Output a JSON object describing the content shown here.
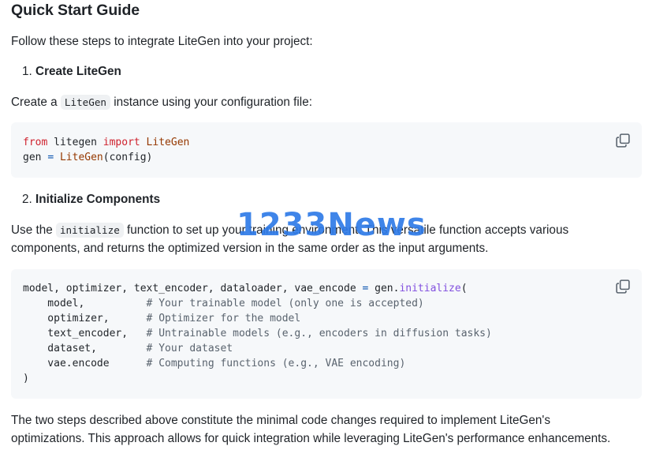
{
  "title": "Quick Start Guide",
  "intro": "Follow these steps to integrate LiteGen into your project:",
  "step1": {
    "number": "1.",
    "title": "Create LiteGen"
  },
  "step1_text": {
    "before": "Create a",
    "code": "LiteGen",
    "after": "instance using your configuration file:"
  },
  "code1": {
    "line1": {
      "from": "from",
      "module": " litegen ",
      "import": "import",
      "name": " LiteGen"
    },
    "line2": {
      "var": "gen ",
      "eq": "=",
      "call": " LiteGen",
      "args": "(config)"
    }
  },
  "step2": {
    "number": "2.",
    "title": "Initialize Components"
  },
  "step2_text": {
    "before": "Use the",
    "code": "initialize",
    "after_line1": "function to set up your training environment. This versatile function accepts various",
    "line2": "components, and returns the optimized version in the same order as the input arguments."
  },
  "code2": {
    "head": {
      "vars": "model, optimizer, text_encoder, dataloader, vae_encode ",
      "eq": "=",
      "obj": " gen.",
      "fn": "initialize",
      "paren": "("
    },
    "rows": [
      {
        "arg": "    model,          ",
        "comment": "# Your trainable model (only one is accepted)"
      },
      {
        "arg": "    optimizer,      ",
        "comment": "# Optimizer for the model"
      },
      {
        "arg": "    text_encoder,   ",
        "comment": "# Untrainable models (e.g., encoders in diffusion tasks)"
      },
      {
        "arg": "    dataset,        ",
        "comment": "# Your dataset"
      },
      {
        "arg": "    vae.encode      ",
        "comment": "# Computing functions (e.g., VAE encoding)"
      }
    ],
    "close": ")"
  },
  "outro_line1": "The two steps described above constitute the minimal code changes required to implement LiteGen's",
  "outro_line2": "optimizations. This approach allows for quick integration while leveraging LiteGen's performance enhancements.",
  "watermark": "1233News",
  "icons": {
    "copy": "copy-icon"
  }
}
